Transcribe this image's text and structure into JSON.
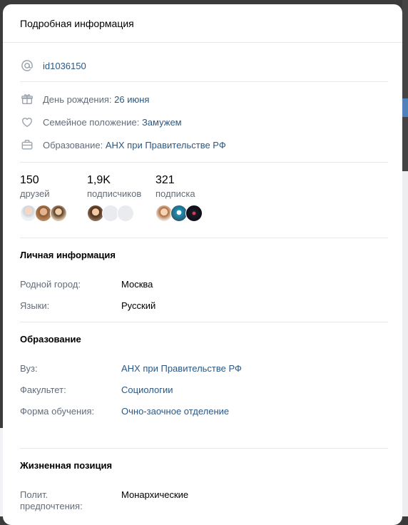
{
  "header": {
    "title": "Подробная информация"
  },
  "profile_id": "id1036150",
  "birthday": {
    "label": "День рождения:",
    "value": "26 июня"
  },
  "family": {
    "label": "Семейное положение:",
    "value": "Замужем"
  },
  "education_short": {
    "label": "Образование:",
    "value": "АНХ при Правительстве РФ"
  },
  "counters": [
    {
      "number": "150",
      "label": "друзей"
    },
    {
      "number": "1,9K",
      "label": "подписчиков"
    },
    {
      "number": "321",
      "label": "подписка"
    }
  ],
  "personal": {
    "title": "Личная информация",
    "rows": [
      {
        "key": "Родной город:",
        "value": "Москва"
      },
      {
        "key": "Языки:",
        "value": "Русский"
      }
    ]
  },
  "education": {
    "title": "Образование",
    "rows": [
      {
        "key": "Вуз:",
        "value": "АНХ при Правительстве РФ"
      },
      {
        "key": "Факультет:",
        "value": "Социологии"
      },
      {
        "key": "Форма обучения:",
        "value": "Очно-заочное отделение"
      }
    ]
  },
  "life": {
    "title": "Жизненная позиция",
    "rows": [
      {
        "key": "Полит. предпочтения:",
        "value": "Монархические"
      }
    ]
  },
  "icons": [
    "at-icon",
    "gift-icon",
    "heart-icon",
    "briefcase-icon"
  ],
  "colors": {
    "link": "#2a5885",
    "muted": "#626d7a",
    "separator": "#e7e8ec"
  }
}
